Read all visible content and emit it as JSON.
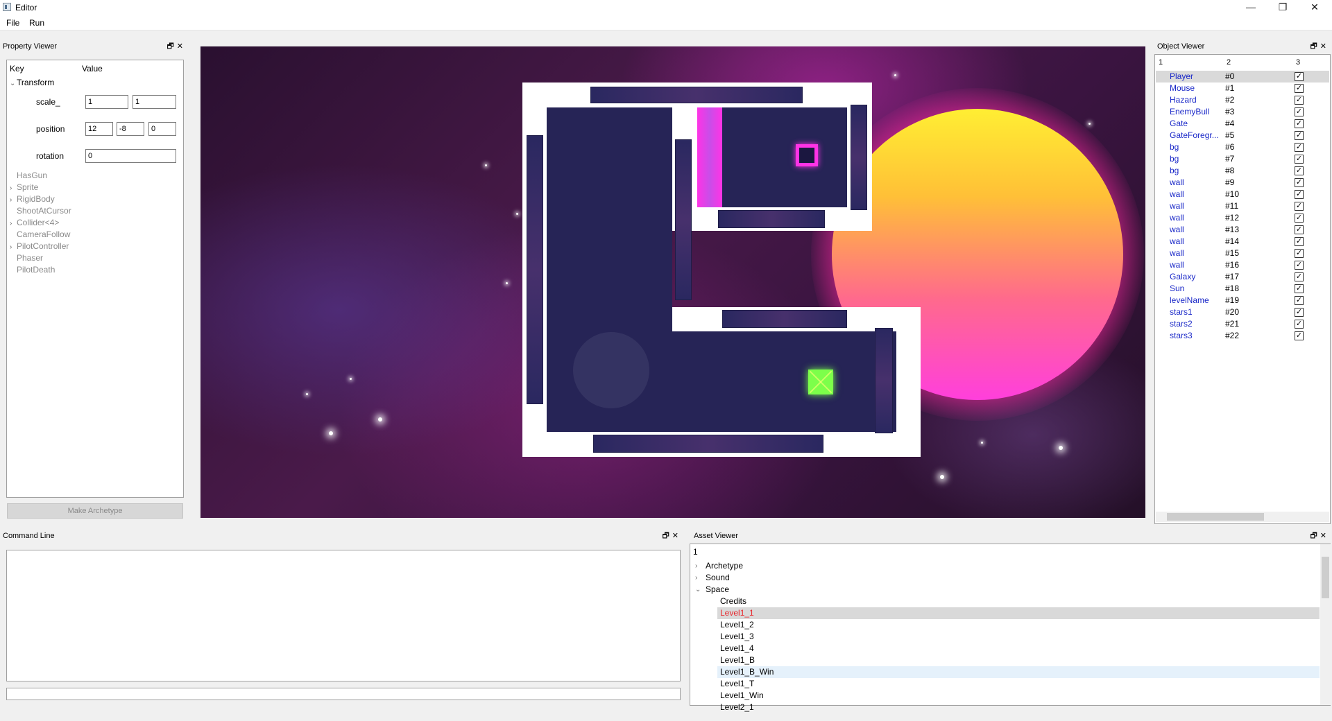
{
  "window": {
    "title": "Editor",
    "minimize": "—",
    "restore": "❐",
    "close": "✕"
  },
  "menu": {
    "file": "File",
    "run": "Run"
  },
  "property_viewer": {
    "title": "Property Viewer",
    "dock_buttons": "🗗✕",
    "header_key": "Key",
    "header_value": "Value",
    "transform": {
      "label": "Transform",
      "scale_label": "scale_",
      "scale": [
        "1",
        "1"
      ],
      "position_label": "position",
      "position": [
        "12",
        "-8",
        "0"
      ],
      "rotation_label": "rotation",
      "rotation": "0"
    },
    "components": [
      {
        "name": "HasGun",
        "expandable": false
      },
      {
        "name": "Sprite",
        "expandable": true
      },
      {
        "name": "RigidBody",
        "expandable": true
      },
      {
        "name": "ShootAtCursor",
        "expandable": false
      },
      {
        "name": "Collider<4>",
        "expandable": true
      },
      {
        "name": "CameraFollow",
        "expandable": false
      },
      {
        "name": "PilotController",
        "expandable": true
      },
      {
        "name": "Phaser",
        "expandable": false
      },
      {
        "name": "PilotDeath",
        "expandable": false
      }
    ],
    "make_archetype": "Make Archetype"
  },
  "object_viewer": {
    "title": "Object Viewer",
    "columns": [
      "1",
      "2",
      "3"
    ],
    "objects": [
      {
        "name": "Player",
        "id": "#0"
      },
      {
        "name": "Mouse",
        "id": "#1"
      },
      {
        "name": "Hazard",
        "id": "#2"
      },
      {
        "name": "EnemyBull",
        "id": "#3"
      },
      {
        "name": "Gate",
        "id": "#4"
      },
      {
        "name": "GateForegr...",
        "id": "#5"
      },
      {
        "name": "bg",
        "id": "#6"
      },
      {
        "name": "bg",
        "id": "#7"
      },
      {
        "name": "bg",
        "id": "#8"
      },
      {
        "name": "wall",
        "id": "#9"
      },
      {
        "name": "wall",
        "id": "#10"
      },
      {
        "name": "wall",
        "id": "#11"
      },
      {
        "name": "wall",
        "id": "#12"
      },
      {
        "name": "wall",
        "id": "#13"
      },
      {
        "name": "wall",
        "id": "#14"
      },
      {
        "name": "wall",
        "id": "#15"
      },
      {
        "name": "wall",
        "id": "#16"
      },
      {
        "name": "Galaxy",
        "id": "#17"
      },
      {
        "name": "Sun",
        "id": "#18"
      },
      {
        "name": "levelName",
        "id": "#19"
      },
      {
        "name": "stars1",
        "id": "#20"
      },
      {
        "name": "stars2",
        "id": "#21"
      },
      {
        "name": "stars3",
        "id": "#22"
      }
    ],
    "check_glyph": "✓"
  },
  "command_line": {
    "title": "Command Line"
  },
  "asset_viewer": {
    "title": "Asset Viewer",
    "column": "1",
    "folders": [
      {
        "name": "Archetype",
        "expanded": false
      },
      {
        "name": "Sound",
        "expanded": false
      },
      {
        "name": "Space",
        "expanded": true
      }
    ],
    "space_items": [
      "Credits",
      "Level1_1",
      "Level1_2",
      "Level1_3",
      "Level1_4",
      "Level1_B",
      "Level1_B_Win",
      "Level1_T",
      "Level1_Win",
      "Level2_1"
    ],
    "selected": "Level1_1",
    "hovered": "Level1_B_Win"
  }
}
